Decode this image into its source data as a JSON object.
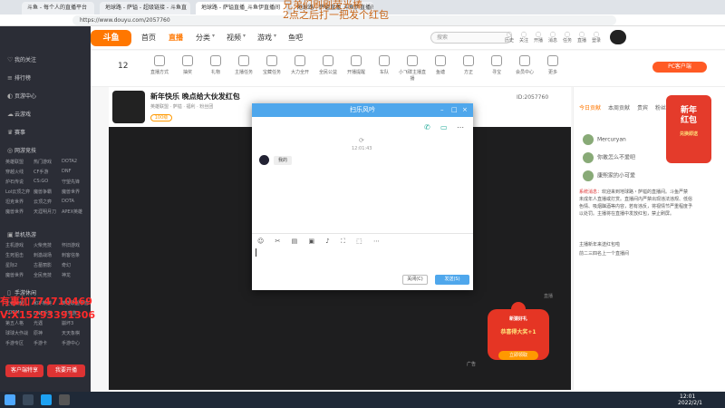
{
  "overlay": {
    "line1": "兄弟们刷刷荧光棒",
    "line2": "2点之后打一把发个红包"
  },
  "tabs": [
    "斗鱼 - 每个人的直播平台",
    "地球路 - 萨镒 - 超级链接 - 斗鱼直",
    "地球路 - 萨镒直播_斗鱼伊直播间",
    "地球路 - 萨镒直播_斗鱼伊直播间"
  ],
  "address": "https://www.douyu.com/2057760",
  "logo": "斗鱼",
  "nav": [
    "首页",
    "直播",
    "分类",
    "视频",
    "游戏",
    "鱼吧"
  ],
  "nav_arrows": [
    "▾",
    "▾",
    "▾"
  ],
  "search_placeholder": "搜索",
  "header_icons": [
    "历史",
    "关注",
    "开播",
    "消息",
    "任务",
    "直播",
    "登录"
  ],
  "categories": [
    "主播冲刺赛",
    "直播方式",
    "抽奖",
    "礼物",
    "主播任务",
    "宝藏任务",
    "大力全开",
    "全民公益",
    "开播提醒",
    "车队",
    "小飞碟主播直播",
    "鱼塘",
    "方正",
    "寻宝",
    "会员中心",
    "更多"
  ],
  "categories_badge": "12",
  "pc_button": "PC客户端",
  "sidebar": {
    "items": [
      "我的关注",
      "排行榜",
      "页游中心",
      "云游戏",
      "赛事",
      "网游竞技"
    ],
    "grid": [
      [
        "英雄联盟",
        "热门游戏",
        "DOTA2"
      ],
      [
        "穿越火线",
        "CF手游",
        "DNF"
      ],
      [
        "炉石传说",
        "CS:GO",
        "守望先锋"
      ],
      [
        "Lol云顶之弈",
        "魔兽争霸",
        "魔兽世界"
      ],
      [
        "坦克世界",
        "云顶之弈",
        "DOTA"
      ],
      [
        "魔兽世界",
        "天涯明月刀",
        "APEX英雄"
      ]
    ],
    "section2": "单机热游",
    "grid2": [
      [
        "主机游戏",
        "火柴竞技",
        "怀旧游戏"
      ],
      [
        "生死狙击",
        "刺激战场",
        "刺客信条"
      ],
      [
        "星际2",
        "古墓丽影",
        "奇幻"
      ],
      [
        "魔兽世界",
        "全民竞技",
        "神龙"
      ]
    ],
    "section3": "手游休闲",
    "grid3": [
      [
        "王者荣耀",
        "和平精英",
        "英雄联盟手游"
      ],
      [
        "CODM",
        "DNF手游",
        "CF手游"
      ],
      [
        "第五人格",
        "光遇",
        "崩坏3"
      ],
      [
        "球球大作战",
        "原神",
        "天天象棋"
      ],
      [
        "手游专区",
        "手游卡",
        "手游中心"
      ]
    ],
    "btn1": "客户端特享",
    "btn2": "我要开播"
  },
  "watermark_left": {
    "line1": "有事加774710469",
    "line2": "V:X15293391306"
  },
  "room": {
    "title": "新年快乐 晚点给大伙发红包",
    "id": "ID:2057760",
    "level": "100级",
    "sub": "英雄联盟 · 萨镒 · 福利 · 粉丝团"
  },
  "right": {
    "tabs": [
      "今日贡献",
      "本周贡献",
      "贵宾",
      "粉丝团"
    ],
    "ranks": [
      {
        "name": "Mercuryan"
      },
      {
        "name": "你敢怎么不爱吧"
      },
      {
        "name": "康熙家的小可爱"
      }
    ],
    "system": "系统消息：",
    "chat": "欢迎来到地球路・萨镒的直播间。斗鱼严禁未成年人直播或打赏。直播间内严禁出现违法违规、低俗色情、吸烟酗酒等内容，若有违反，将视情节严重程度予以处罚。主播将在直播中发放红包，禁止刷屏。",
    "chat2": "主播新年来送红包啦",
    "chat3": "前二三四名上一个直播间"
  },
  "ad": {
    "line1": "新年",
    "line2": "红包",
    "sub": "兑换即送"
  },
  "modal": {
    "title": "扫乐风吟",
    "time": "12:01:43",
    "bubble": "我的",
    "tools": "☺ ✂ ▤ ▣ ♪ ⛶ ⬚ ⋯",
    "close": "关闭(C)",
    "send": "发送(S)"
  },
  "newbie": {
    "title": "新猿好礼",
    "main": "恭喜得大奖+1",
    "btn": "立即领取"
  },
  "clock": {
    "time": "12:01",
    "date": "2022/2/1"
  },
  "ad_label": "广告",
  "player_label": "直播"
}
